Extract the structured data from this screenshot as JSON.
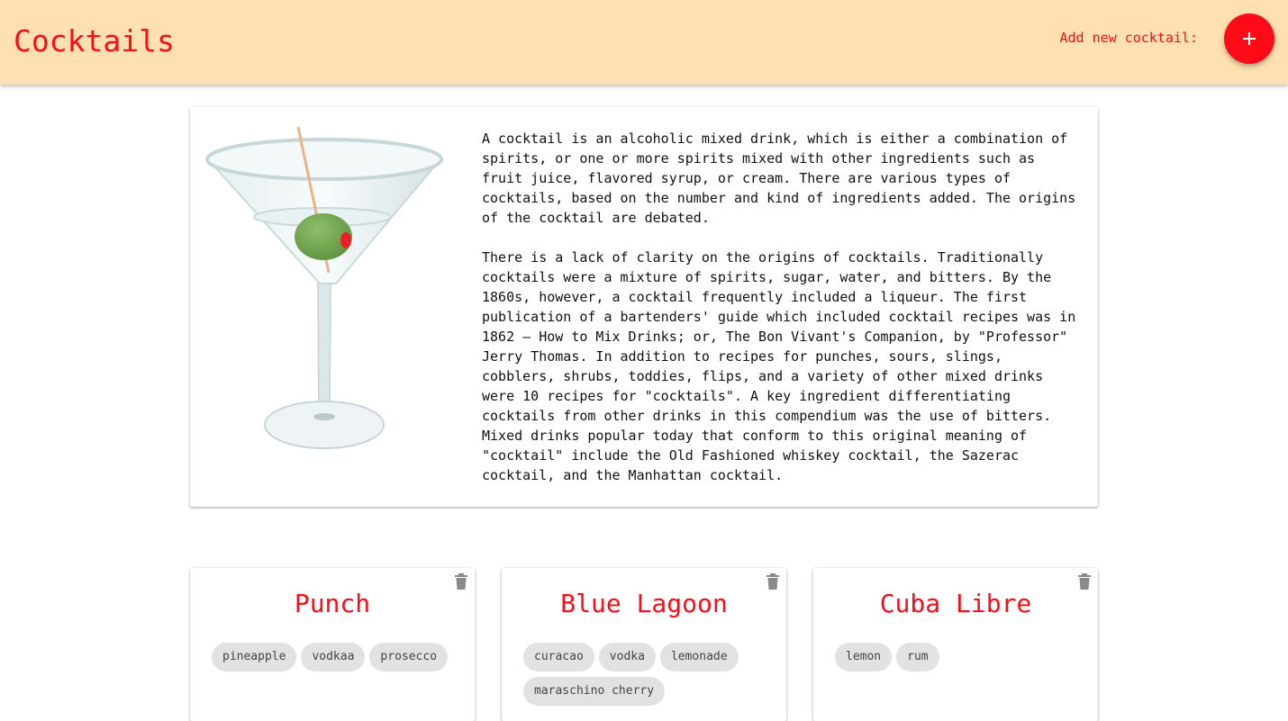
{
  "header": {
    "title": "Cocktails",
    "add_label": "Add new cocktail:",
    "add_button_icon": "plus-icon",
    "background_color": "#ffe0b0",
    "accent_color": "#ff0a16"
  },
  "intro": {
    "image": "martini-glass-with-olive",
    "paragraphs": [
      "A cocktail is an alcoholic mixed drink, which is either a combination of\nspirits, or one or more spirits mixed with other ingredients such as\nfruit juice, flavored syrup, or cream. There are various types of\ncocktails, based on the number and kind of ingredients added. The origins\nof the cocktail are debated.",
      "There is a lack of clarity on the origins of cocktails. Traditionally\ncocktails were a mixture of spirits, sugar, water, and bitters. By the\n1860s, however, a cocktail frequently included a liqueur. The first\npublication of a bartenders' guide which included cocktail recipes was in\n1862 – How to Mix Drinks; or, The Bon Vivant's Companion, by \"Professor\"\nJerry Thomas. In addition to recipes for punches, sours, slings,\ncobblers, shrubs, toddies, flips, and a variety of other mixed drinks\nwere 10 recipes for \"cocktails\". A key ingredient differentiating\ncocktails from other drinks in this compendium was the use of bitters.\nMixed drinks popular today that conform to this original meaning of\n\"cocktail\" include the Old Fashioned whiskey cocktail, the Sazerac\ncocktail, and the Manhattan cocktail."
    ]
  },
  "cocktails": [
    {
      "name": "Punch",
      "delete_icon": "trash-icon",
      "ingredients": [
        "pineapple",
        "vodkaa",
        "prosecco"
      ]
    },
    {
      "name": "Blue Lagoon",
      "delete_icon": "trash-icon",
      "ingredients": [
        "curacao",
        "vodka",
        "lemonade",
        "maraschino cherry"
      ]
    },
    {
      "name": "Cuba Libre",
      "delete_icon": "trash-icon",
      "ingredients": [
        "lemon",
        "rum"
      ]
    }
  ]
}
